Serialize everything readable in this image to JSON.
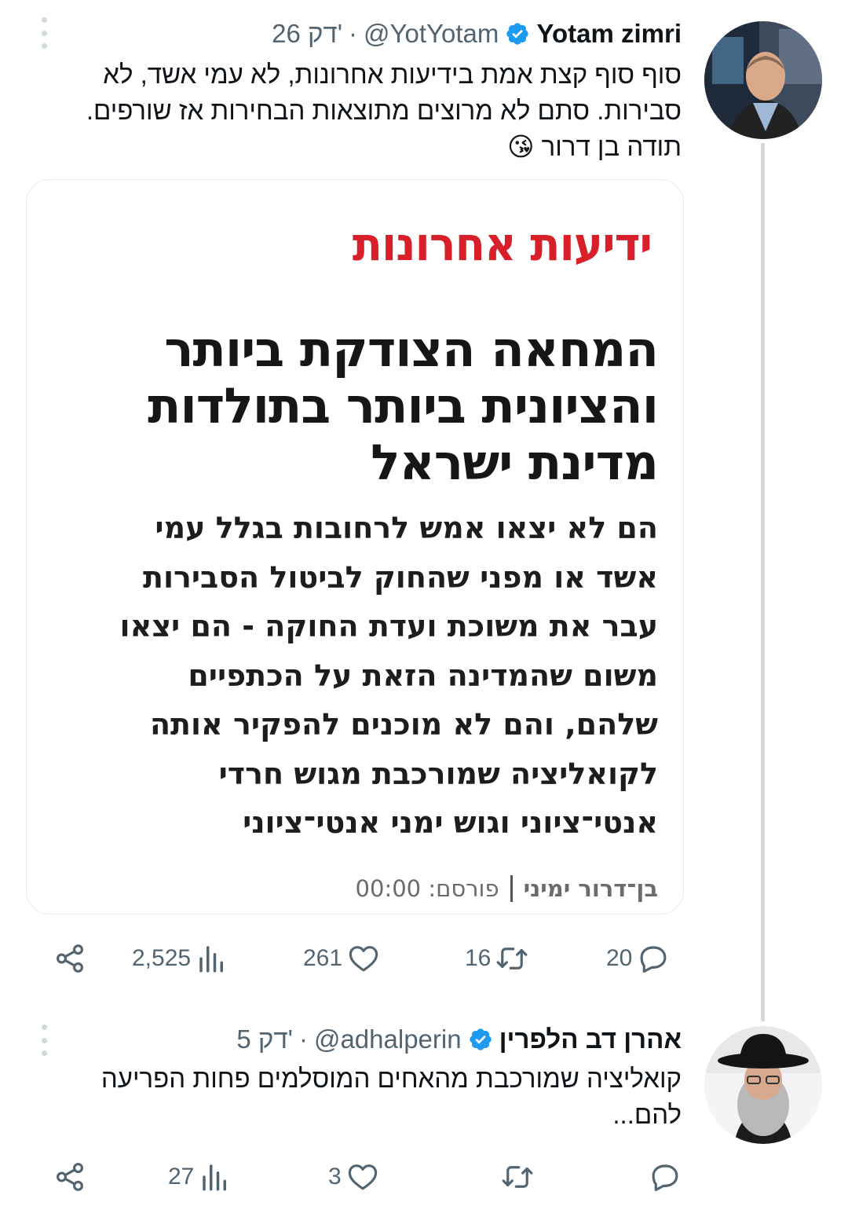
{
  "tweet1": {
    "name": "Yotam zimri",
    "handle": "@YotYotam",
    "dot": "·",
    "time": "26 דק'",
    "text_lines": [
      "סוף סוף קצת אמת בידיעות אחרונות, לא עמי אשד, לא",
      "סבירות. סתם לא מרוצים מתוצאות הבחירות אז שורפים.",
      "תודה בן דרור 😘"
    ],
    "card": {
      "paper_name": "ידיעות אחרונות",
      "headline_lines": [
        "המחאה הצודקת ביותר",
        "והציונית ביותר בתולדות",
        "מדינת ישראל"
      ],
      "body_lines": [
        "הם לא יצאו אמש לרחובות בגלל עמי",
        "אשד או מפני שהחוק לביטול הסבירות",
        "עבר את משוכת ועדת החוקה - הם יצאו",
        "משום שהמדינה הזאת על הכתפיים",
        "שלהם, והם לא מוכנים להפקיר אותה",
        "לקואליציה שמורכבת מגוש חרדי",
        "אנטי־ציוני וגוש ימני אנטי־ציוני"
      ],
      "author": "בן־דרור ימיני",
      "published": "פורסם: 00:00"
    },
    "actions": {
      "replies": "20",
      "retweets": "16",
      "likes": "261",
      "views": "2,525"
    }
  },
  "tweet2": {
    "name": "אהרן דב הלפרין",
    "handle": "@adhalperin",
    "dot": "·",
    "time": "5 דק'",
    "text_lines": [
      "קואליציה שמורכבת מהאחים המוסלמים פחות הפריעה",
      "להם..."
    ],
    "actions": {
      "replies": "",
      "retweets": "",
      "likes": "3",
      "views": "27"
    }
  },
  "colors": {
    "verified": "#1d9bf0",
    "muted": "#536471",
    "paper_red": "#d8202a"
  }
}
